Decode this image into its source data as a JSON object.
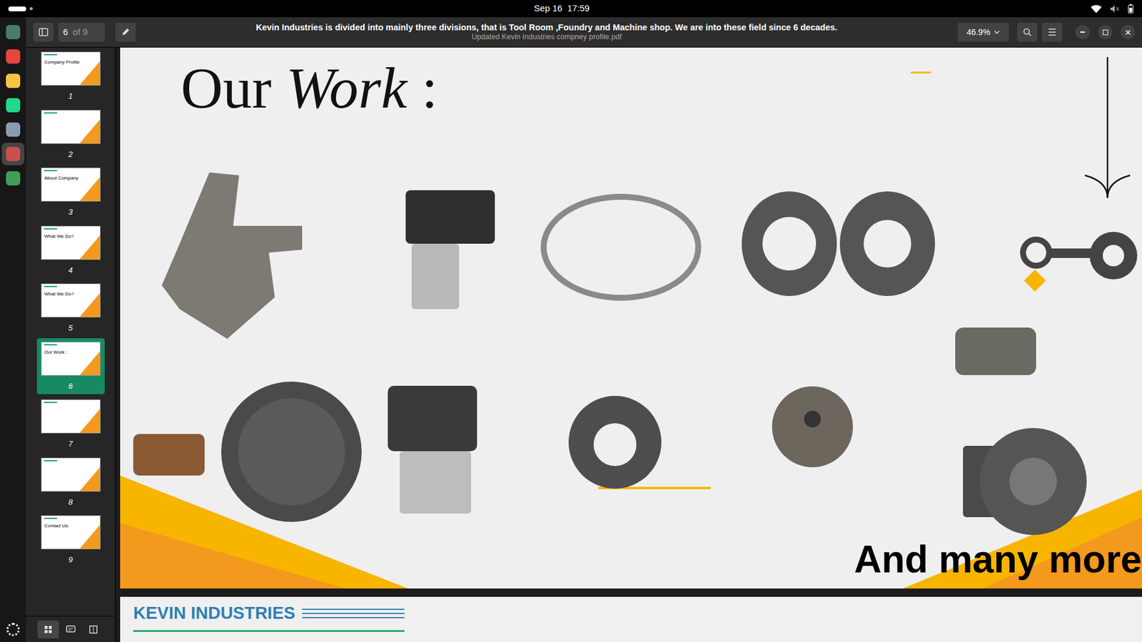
{
  "topbar": {
    "clock": "Sep 16  17:59"
  },
  "dock": [
    {
      "app": "files",
      "selected": false
    },
    {
      "app": "chrome",
      "selected": false
    },
    {
      "app": "editor",
      "selected": false
    },
    {
      "app": "pycharm",
      "selected": false
    },
    {
      "app": "image-viewer",
      "selected": false
    },
    {
      "app": "document-viewer",
      "selected": true
    },
    {
      "app": "trash",
      "selected": false
    }
  ],
  "window": {
    "title": "Kevin Industries is divided into mainly three divisions, that is Tool Room ,Foundry and Machine shop. We are into these field since 6 decades.",
    "subtitle": "Updated Kevin Industries compney profile.pdf",
    "page": "6",
    "page_count": "of 9",
    "zoom": "46.9%"
  },
  "sidebar": {
    "thumbnails": [
      {
        "label": "1",
        "title": "Company Profile",
        "selected": false
      },
      {
        "label": "2",
        "title": "",
        "selected": false
      },
      {
        "label": "3",
        "title": "About Company",
        "selected": false
      },
      {
        "label": "4",
        "title": "What We Do?",
        "selected": false
      },
      {
        "label": "5",
        "title": "What We Do?",
        "selected": false
      },
      {
        "label": "6",
        "title": "Our Work :",
        "selected": true
      },
      {
        "label": "7",
        "title": "",
        "selected": false
      },
      {
        "label": "8",
        "title": "",
        "selected": false
      },
      {
        "label": "9",
        "title": "Contact Us:",
        "selected": false
      }
    ],
    "view_buttons": [
      {
        "view": "thumbnails",
        "selected": true
      },
      {
        "view": "annotations",
        "selected": false
      },
      {
        "view": "outline",
        "selected": false
      }
    ]
  },
  "page": {
    "heading_plain": "Our ",
    "heading_italic": "Work",
    "heading_end": " :",
    "footer": "And many more"
  },
  "next_page": {
    "heading": "KEVIN INDUSTRIES"
  }
}
